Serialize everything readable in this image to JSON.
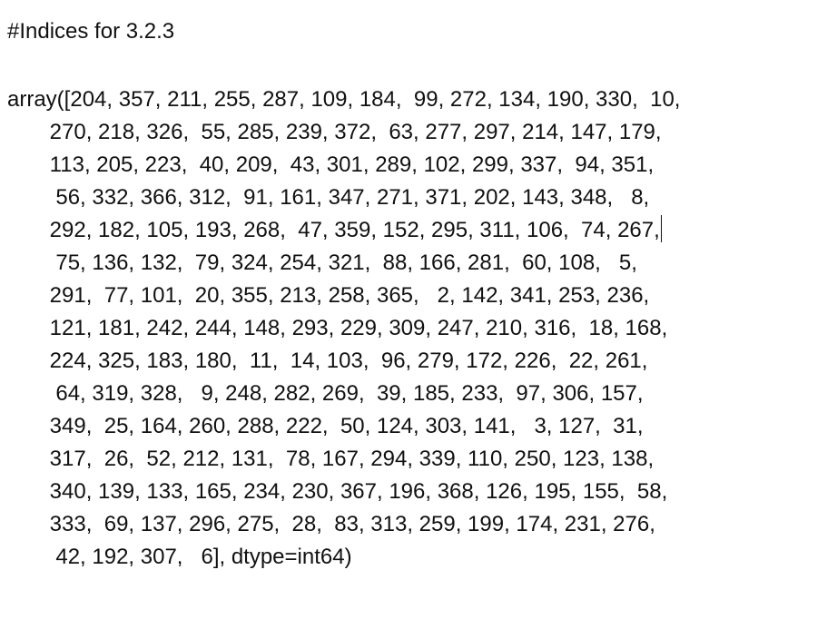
{
  "document": {
    "heading": "#Indices for 3.2.3",
    "output_lines": [
      "array([204, 357, 211, 255, 287, 109, 184,  99, 272, 134, 190, 330,  10,",
      "       270, 218, 326,  55, 285, 239, 372,  63, 277, 297, 214, 147, 179,",
      "       113, 205, 223,  40, 209,  43, 301, 289, 102, 299, 337,  94, 351,",
      "        56, 332, 366, 312,  91, 161, 347, 271, 371, 202, 143, 348,   8,",
      "       292, 182, 105, 193, 268,  47, 359, 152, 295, 311, 106,  74, 267,",
      "        75, 136, 132,  79, 324, 254, 321,  88, 166, 281,  60, 108,   5,",
      "       291,  77, 101,  20, 355, 213, 258, 365,   2, 142, 341, 253, 236,",
      "       121, 181, 242, 244, 148, 293, 229, 309, 247, 210, 316,  18, 168,",
      "       224, 325, 183, 180,  11,  14, 103,  96, 279, 172, 226,  22, 261,",
      "        64, 319, 328,   9, 248, 282, 269,  39, 185, 233,  97, 306, 157,",
      "       349,  25, 164, 260, 288, 222,  50, 124, 303, 141,   3, 127,  31,",
      "       317,  26,  52, 212, 131,  78, 167, 294, 339, 110, 250, 123, 138,",
      "       340, 139, 133, 165, 234, 230, 367, 196, 368, 126, 195, 155,  58,",
      "       333,  69, 137, 296, 275,  28,  83, 313, 259, 199, 174, 231, 276,",
      "        42, 192, 307,   6], dtype=int64)"
    ]
  }
}
